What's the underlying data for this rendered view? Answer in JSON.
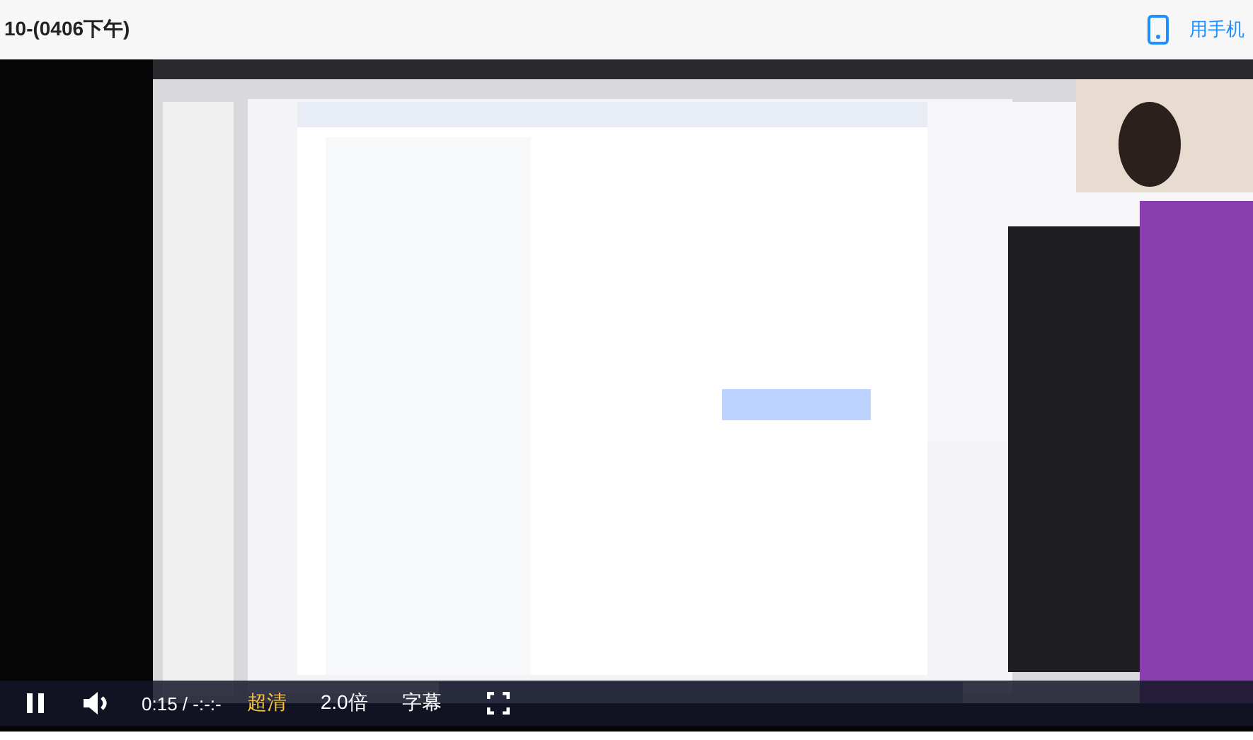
{
  "header": {
    "title": "10-(0406下午)",
    "mobile_link": "用手机"
  },
  "controls": {
    "playing": true,
    "time": "0:15 / -:-:-",
    "quality": "超清",
    "speed": "2.0倍",
    "subtitles": "字幕"
  }
}
